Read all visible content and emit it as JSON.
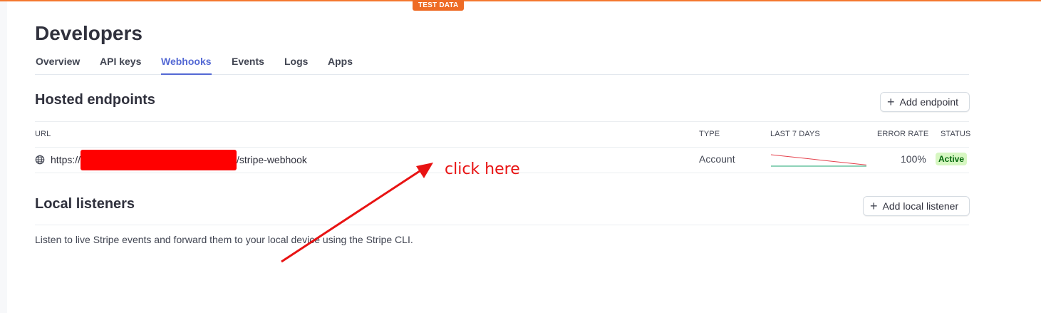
{
  "environment_badge": "TEST DATA",
  "page": {
    "title": "Developers"
  },
  "tabs": [
    {
      "label": "Overview",
      "active": false
    },
    {
      "label": "API keys",
      "active": false
    },
    {
      "label": "Webhooks",
      "active": true
    },
    {
      "label": "Events",
      "active": false
    },
    {
      "label": "Logs",
      "active": false
    },
    {
      "label": "Apps",
      "active": false
    }
  ],
  "hosted_endpoints": {
    "title": "Hosted endpoints",
    "add_button_label": "Add endpoint",
    "columns": [
      "URL",
      "TYPE",
      "LAST 7 DAYS",
      "ERROR RATE",
      "STATUS"
    ],
    "rows": [
      {
        "url_prefix": "https://",
        "url_suffix": "/stripe-webhook",
        "type": "Account",
        "error_rate": "100%",
        "status": "Active",
        "last_7_days": {
          "errors": [
            1,
            0.85,
            0.7,
            0.55,
            0.4,
            0.25,
            0.1
          ],
          "successes": [
            0,
            0,
            0,
            0,
            0,
            0,
            0
          ]
        }
      }
    ]
  },
  "local_listeners": {
    "title": "Local listeners",
    "add_button_label": "Add local listener",
    "description": "Listen to live Stripe events and forward them to your local device using the Stripe CLI."
  },
  "annotation": {
    "text": "click here"
  },
  "colors": {
    "accent": "#5469d4",
    "test_badge": "#ee6b25",
    "status_active_bg": "#d7f7c2",
    "status_active_text": "#05690d",
    "error_line": "#e5424d",
    "success_line": "#1ea672",
    "annotation_red": "#e81313",
    "redaction": "#ff0000"
  },
  "icons": {
    "url_icon": "globe-icon",
    "add_icon": "plus-icon"
  }
}
